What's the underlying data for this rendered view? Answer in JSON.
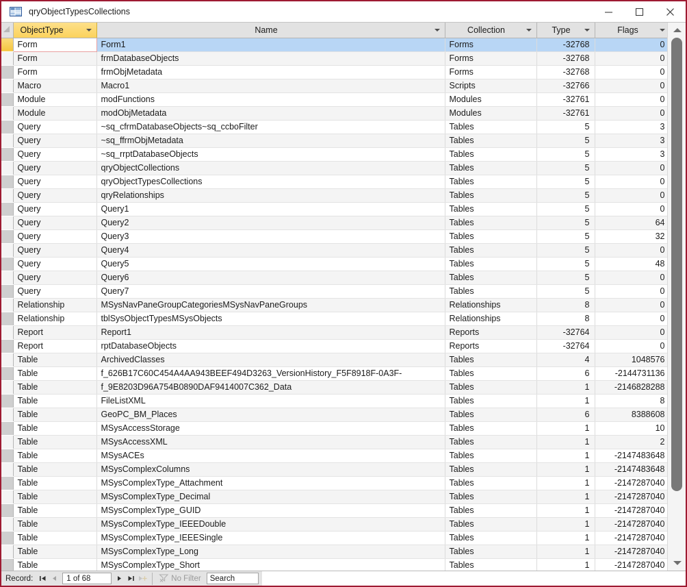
{
  "window": {
    "title": "qryObjectTypesCollections",
    "icon": "query-datasheet-icon",
    "minimize_label": "Minimize",
    "maximize_label": "Maximize",
    "close_label": "Close",
    "accent_border": "#9e1b32",
    "active_header_color": "#fbd25c",
    "selected_row_color": "#b8d6f5"
  },
  "grid": {
    "select_all_tooltip": "Select All",
    "columns": [
      {
        "key": "ObjectType",
        "label": "ObjectType",
        "active": true,
        "align": "left"
      },
      {
        "key": "Name",
        "label": "Name",
        "active": false,
        "align": "left"
      },
      {
        "key": "Collection",
        "label": "Collection",
        "active": false,
        "align": "left"
      },
      {
        "key": "Type",
        "label": "Type",
        "active": false,
        "align": "right"
      },
      {
        "key": "Flags",
        "label": "Flags",
        "active": false,
        "align": "right"
      }
    ],
    "rows": [
      {
        "ObjectType": "Form",
        "Name": "Form1",
        "Collection": "Forms",
        "Type": "-32768",
        "Flags": "0",
        "current": true
      },
      {
        "ObjectType": "Form",
        "Name": "frmDatabaseObjects",
        "Collection": "Forms",
        "Type": "-32768",
        "Flags": "0"
      },
      {
        "ObjectType": "Form",
        "Name": "frmObjMetadata",
        "Collection": "Forms",
        "Type": "-32768",
        "Flags": "0"
      },
      {
        "ObjectType": "Macro",
        "Name": "Macro1",
        "Collection": "Scripts",
        "Type": "-32766",
        "Flags": "0"
      },
      {
        "ObjectType": "Module",
        "Name": "modFunctions",
        "Collection": "Modules",
        "Type": "-32761",
        "Flags": "0"
      },
      {
        "ObjectType": "Module",
        "Name": "modObjMetadata",
        "Collection": "Modules",
        "Type": "-32761",
        "Flags": "0"
      },
      {
        "ObjectType": "Query",
        "Name": "~sq_cfrmDatabaseObjects~sq_ccboFilter",
        "Collection": "Tables",
        "Type": "5",
        "Flags": "3"
      },
      {
        "ObjectType": "Query",
        "Name": "~sq_ffrmObjMetadata",
        "Collection": "Tables",
        "Type": "5",
        "Flags": "3"
      },
      {
        "ObjectType": "Query",
        "Name": "~sq_rrptDatabaseObjects",
        "Collection": "Tables",
        "Type": "5",
        "Flags": "3"
      },
      {
        "ObjectType": "Query",
        "Name": "qryObjectCollections",
        "Collection": "Tables",
        "Type": "5",
        "Flags": "0"
      },
      {
        "ObjectType": "Query",
        "Name": "qryObjectTypesCollections",
        "Collection": "Tables",
        "Type": "5",
        "Flags": "0"
      },
      {
        "ObjectType": "Query",
        "Name": "qryRelationships",
        "Collection": "Tables",
        "Type": "5",
        "Flags": "0"
      },
      {
        "ObjectType": "Query",
        "Name": "Query1",
        "Collection": "Tables",
        "Type": "5",
        "Flags": "0"
      },
      {
        "ObjectType": "Query",
        "Name": "Query2",
        "Collection": "Tables",
        "Type": "5",
        "Flags": "64"
      },
      {
        "ObjectType": "Query",
        "Name": "Query3",
        "Collection": "Tables",
        "Type": "5",
        "Flags": "32"
      },
      {
        "ObjectType": "Query",
        "Name": "Query4",
        "Collection": "Tables",
        "Type": "5",
        "Flags": "0"
      },
      {
        "ObjectType": "Query",
        "Name": "Query5",
        "Collection": "Tables",
        "Type": "5",
        "Flags": "48"
      },
      {
        "ObjectType": "Query",
        "Name": "Query6",
        "Collection": "Tables",
        "Type": "5",
        "Flags": "0"
      },
      {
        "ObjectType": "Query",
        "Name": "Query7",
        "Collection": "Tables",
        "Type": "5",
        "Flags": "0"
      },
      {
        "ObjectType": "Relationship",
        "Name": "MSysNavPaneGroupCategoriesMSysNavPaneGroups",
        "Collection": "Relationships",
        "Type": "8",
        "Flags": "0"
      },
      {
        "ObjectType": "Relationship",
        "Name": "tblSysObjectTypesMSysObjects",
        "Collection": "Relationships",
        "Type": "8",
        "Flags": "0"
      },
      {
        "ObjectType": "Report",
        "Name": "Report1",
        "Collection": "Reports",
        "Type": "-32764",
        "Flags": "0"
      },
      {
        "ObjectType": "Report",
        "Name": "rptDatabaseObjects",
        "Collection": "Reports",
        "Type": "-32764",
        "Flags": "0"
      },
      {
        "ObjectType": "Table",
        "Name": "ArchivedClasses",
        "Collection": "Tables",
        "Type": "4",
        "Flags": "1048576"
      },
      {
        "ObjectType": "Table",
        "Name": "f_626B17C60C454A4AA943BEEF494D3263_VersionHistory_F5F8918F-0A3F-",
        "Collection": "Tables",
        "Type": "6",
        "Flags": "-2144731136"
      },
      {
        "ObjectType": "Table",
        "Name": "f_9E8203D96A754B0890DAF9414007C362_Data",
        "Collection": "Tables",
        "Type": "1",
        "Flags": "-2146828288"
      },
      {
        "ObjectType": "Table",
        "Name": "FileListXML",
        "Collection": "Tables",
        "Type": "1",
        "Flags": "8"
      },
      {
        "ObjectType": "Table",
        "Name": "GeoPC_BM_Places",
        "Collection": "Tables",
        "Type": "6",
        "Flags": "8388608"
      },
      {
        "ObjectType": "Table",
        "Name": "MSysAccessStorage",
        "Collection": "Tables",
        "Type": "1",
        "Flags": "10"
      },
      {
        "ObjectType": "Table",
        "Name": "MSysAccessXML",
        "Collection": "Tables",
        "Type": "1",
        "Flags": "2"
      },
      {
        "ObjectType": "Table",
        "Name": "MSysACEs",
        "Collection": "Tables",
        "Type": "1",
        "Flags": "-2147483648"
      },
      {
        "ObjectType": "Table",
        "Name": "MSysComplexColumns",
        "Collection": "Tables",
        "Type": "1",
        "Flags": "-2147483648"
      },
      {
        "ObjectType": "Table",
        "Name": "MSysComplexType_Attachment",
        "Collection": "Tables",
        "Type": "1",
        "Flags": "-2147287040"
      },
      {
        "ObjectType": "Table",
        "Name": "MSysComplexType_Decimal",
        "Collection": "Tables",
        "Type": "1",
        "Flags": "-2147287040"
      },
      {
        "ObjectType": "Table",
        "Name": "MSysComplexType_GUID",
        "Collection": "Tables",
        "Type": "1",
        "Flags": "-2147287040"
      },
      {
        "ObjectType": "Table",
        "Name": "MSysComplexType_IEEEDouble",
        "Collection": "Tables",
        "Type": "1",
        "Flags": "-2147287040"
      },
      {
        "ObjectType": "Table",
        "Name": "MSysComplexType_IEEESingle",
        "Collection": "Tables",
        "Type": "1",
        "Flags": "-2147287040"
      },
      {
        "ObjectType": "Table",
        "Name": "MSysComplexType_Long",
        "Collection": "Tables",
        "Type": "1",
        "Flags": "-2147287040"
      },
      {
        "ObjectType": "Table",
        "Name": "MSysComplexType_Short",
        "Collection": "Tables",
        "Type": "1",
        "Flags": "-2147287040"
      }
    ]
  },
  "scrollbar": {
    "up_icon": "scroll-up-arrow",
    "down_icon": "scroll-down-arrow"
  },
  "navbar": {
    "record_label": "Record:",
    "first_icon": "first-record-icon",
    "prev_icon": "previous-record-icon",
    "position_value": "1 of 68",
    "next_icon": "next-record-icon",
    "last_icon": "last-record-icon",
    "new_icon": "new-record-icon",
    "filter_icon": "filter-icon",
    "filter_label": "No Filter",
    "search_value": "Search"
  }
}
